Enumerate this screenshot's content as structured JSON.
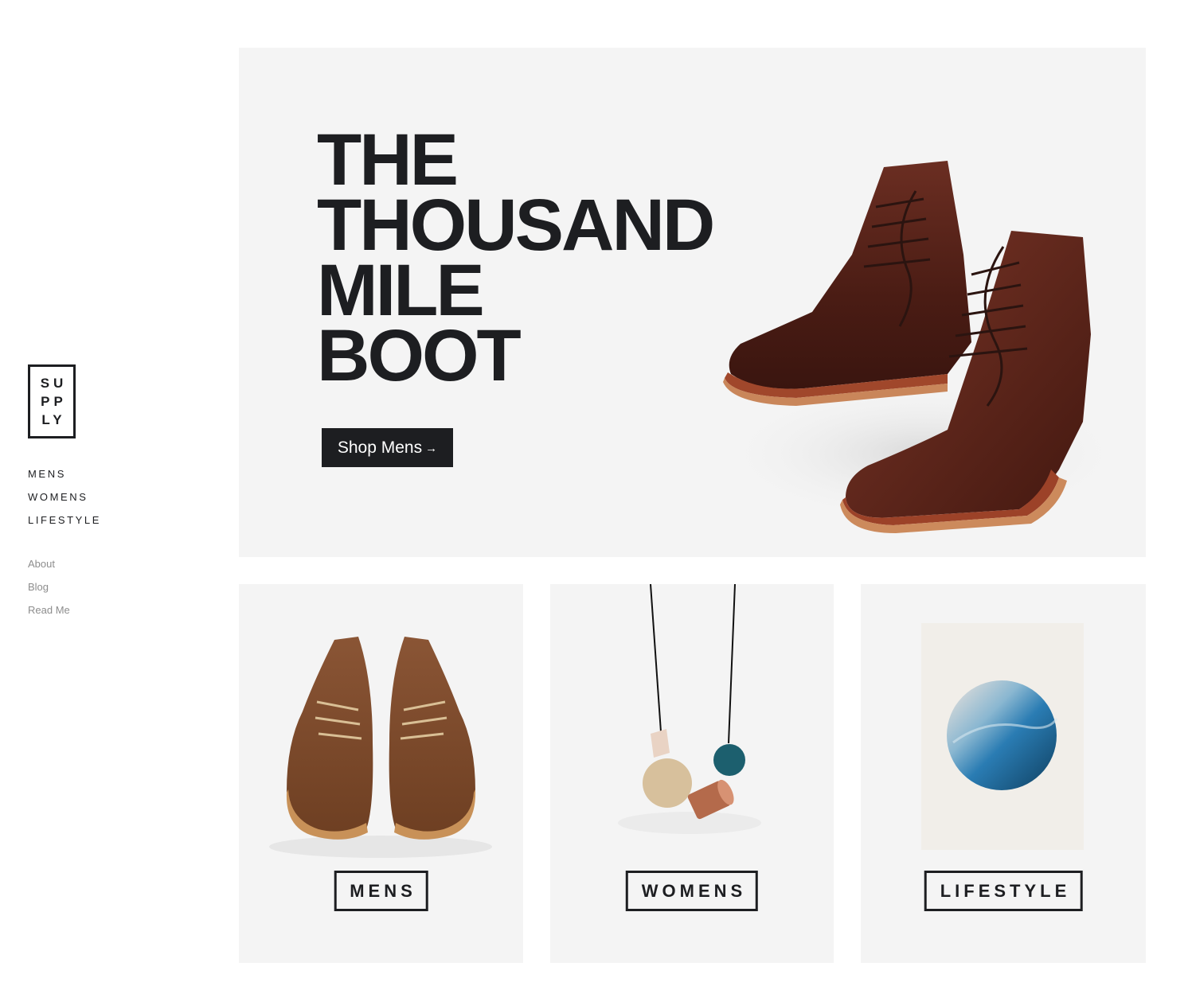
{
  "brand": {
    "logo_lines": [
      "SU",
      "PP",
      "LY"
    ]
  },
  "nav": {
    "primary": [
      "MENS",
      "WOMENS",
      "LIFESTYLE"
    ],
    "secondary": [
      "About",
      "Blog",
      "Read Me"
    ]
  },
  "hero": {
    "title_lines": [
      "THE",
      "THOUSAND",
      "MILE",
      "BOOT"
    ],
    "button_label": "Shop Mens",
    "button_icon": "→",
    "background": "#f4f4f4"
  },
  "categories": [
    {
      "label": "MENS",
      "image": "brown-chukka-boots"
    },
    {
      "label": "WOMENS",
      "image": "bead-necklace"
    },
    {
      "label": "LIFESTYLE",
      "image": "ocean-print-poster"
    }
  ],
  "colors": {
    "ink": "#1d1e21",
    "muted": "#8d8d8d",
    "panel": "#f4f4f4"
  }
}
